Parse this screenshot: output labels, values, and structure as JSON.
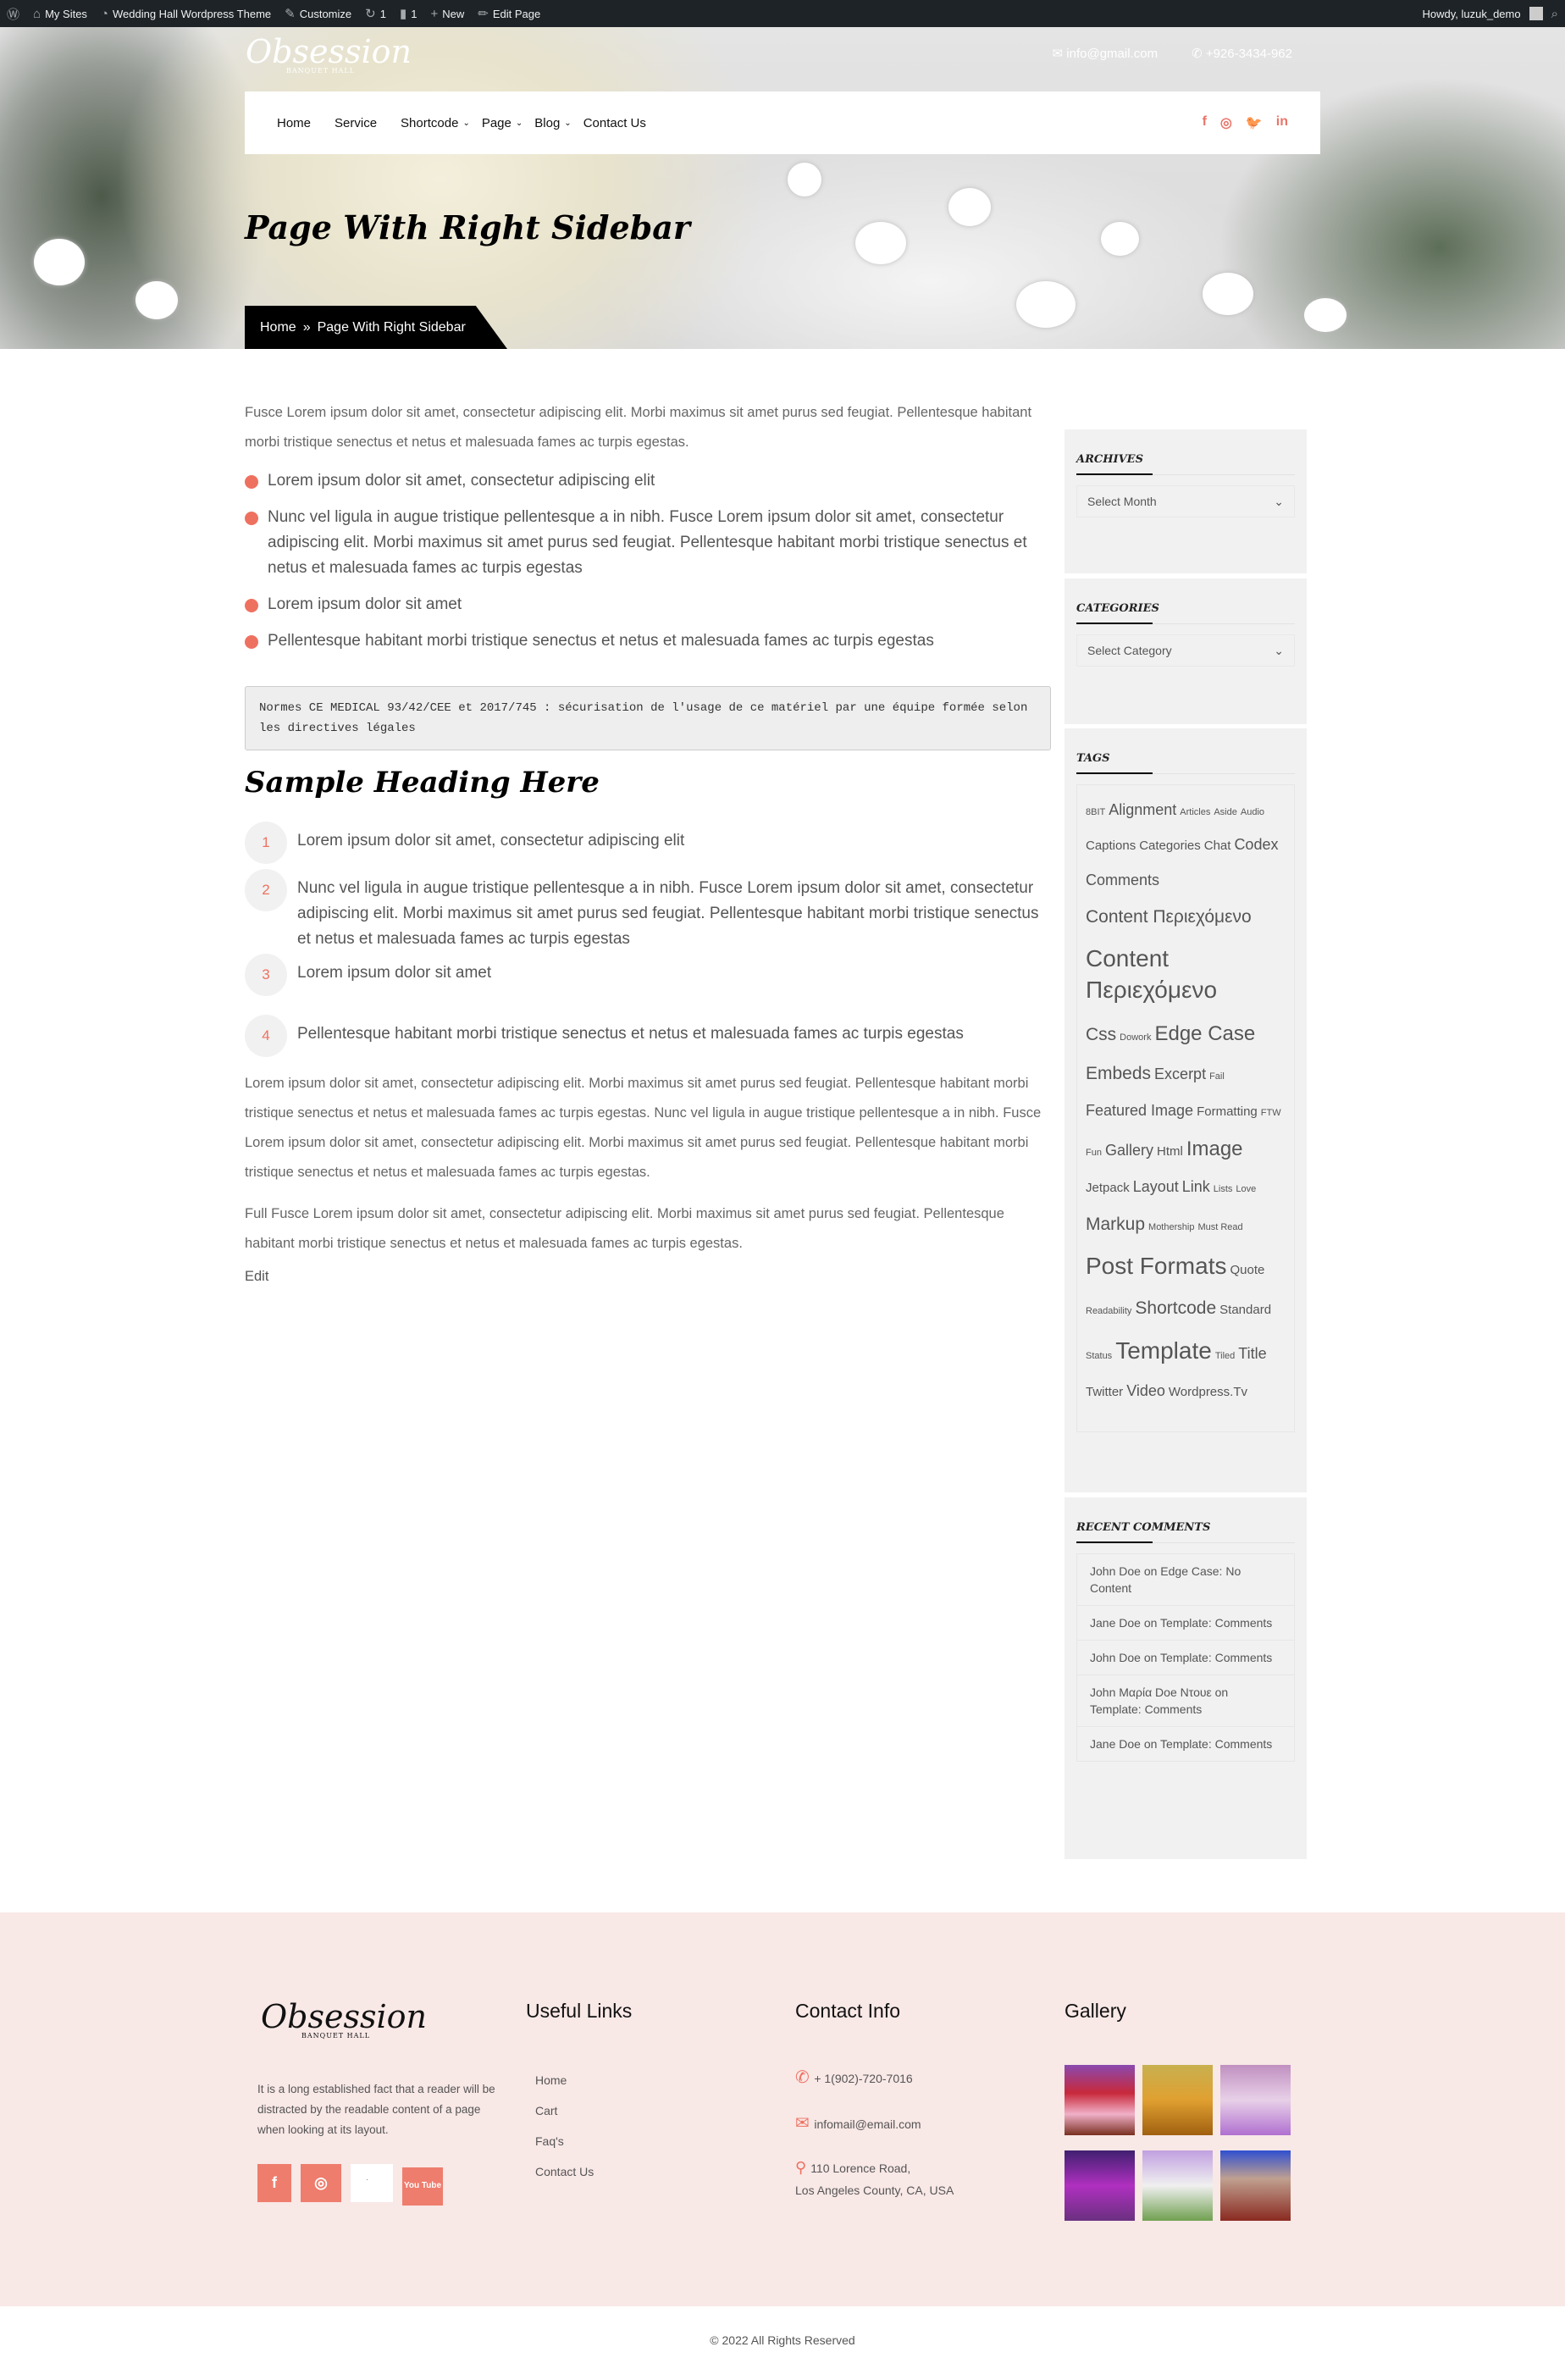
{
  "adminbar": {
    "items": [
      {
        "icon": "wordpress-icon",
        "label": ""
      },
      {
        "icon": "my-sites-icon",
        "label": "My Sites"
      },
      {
        "icon": "dashboard-icon",
        "label": "Wedding Hall Wordpress Theme"
      },
      {
        "icon": "brush-icon",
        "label": "Customize"
      },
      {
        "icon": "updates-icon",
        "label": "1"
      },
      {
        "icon": "comment-icon",
        "label": "1"
      },
      {
        "icon": "plus-icon",
        "label": "New"
      },
      {
        "icon": "pencil-icon",
        "label": "Edit Page"
      }
    ],
    "howdy": "Howdy, luzuk_demo"
  },
  "header": {
    "logo": "Obsession",
    "logo_sub": "BANQUET HALL",
    "email": "info@gmail.com",
    "phone": "+926-3434-962",
    "nav": [
      {
        "label": "Home",
        "dropdown": false
      },
      {
        "label": "Service",
        "dropdown": false
      },
      {
        "label": "Shortcode",
        "dropdown": true
      },
      {
        "label": "Page",
        "dropdown": true
      },
      {
        "label": "Blog",
        "dropdown": true
      },
      {
        "label": "Contact Us",
        "dropdown": false
      }
    ],
    "social": [
      "f",
      "◎",
      "🐦",
      "in"
    ]
  },
  "hero": {
    "title": "Page With Right Sidebar",
    "breadcrumb": [
      "Home",
      "Page With Right Sidebar"
    ]
  },
  "main": {
    "intro": "Fusce Lorem ipsum dolor sit amet, consectetur adipiscing elit. Morbi maximus sit amet purus sed feugiat. Pellentesque habitant morbi tristique senectus et netus et malesuada fames ac turpis egestas.",
    "bullets": [
      "Lorem ipsum dolor sit amet, consectetur adipiscing elit",
      "Nunc vel ligula in augue tristique pellentesque a in nibh. Fusce Lorem ipsum dolor sit amet, consectetur adipiscing elit. Morbi maximus sit amet purus sed feugiat. Pellentesque habitant morbi tristique senectus et netus et malesuada fames ac turpis egestas",
      "Lorem ipsum dolor sit amet",
      "Pellentesque habitant morbi tristique senectus et netus et malesuada fames ac turpis egestas"
    ],
    "pre": "Normes CE MEDICAL 93/42/CEE et 2017/745 : sécurisation de l'usage de ce matériel par une équipe formée selon les directives légales",
    "heading": "Sample Heading Here",
    "numbered": [
      "Lorem ipsum dolor sit amet, consectetur adipiscing elit",
      "Nunc vel ligula in augue tristique pellentesque a in nibh. Fusce Lorem ipsum dolor sit amet, consectetur adipiscing elit. Morbi maximus sit amet purus sed feugiat. Pellentesque habitant morbi tristique senectus et netus et malesuada fames ac turpis egestas",
      "Lorem ipsum dolor sit amet",
      "Pellentesque habitant morbi tristique senectus et netus et malesuada fames ac turpis egestas"
    ],
    "para1": "Lorem ipsum dolor sit amet, consectetur adipiscing elit. Morbi maximus sit amet purus sed feugiat. Pellentesque habitant morbi tristique senectus et netus et malesuada fames ac turpis egestas. Nunc vel ligula in augue tristique pellentesque a in nibh. Fusce Lorem ipsum dolor sit amet, consectetur adipiscing elit. Morbi maximus sit amet purus sed feugiat. Pellentesque habitant morbi tristique senectus et netus et malesuada fames ac turpis egestas.",
    "para2": "Full Fusce Lorem ipsum dolor sit amet, consectetur adipiscing elit. Morbi maximus sit amet purus sed feugiat. Pellentesque habitant morbi tristique senectus et netus et malesuada fames ac turpis egestas.",
    "edit": "Edit"
  },
  "sidebar": {
    "archives": {
      "title": "ARCHIVES",
      "select": "Select Month"
    },
    "categories": {
      "title": "CATEGORIES",
      "select": "Select Category"
    },
    "tags": {
      "title": "TAGS",
      "items": [
        [
          "8BIT",
          1
        ],
        [
          "Alignment",
          3
        ],
        [
          "Articles",
          1
        ],
        [
          "Aside",
          1
        ],
        [
          "Audio",
          1
        ],
        [
          "Captions",
          2
        ],
        [
          "Categories",
          2
        ],
        [
          "Chat",
          2
        ],
        [
          "Codex",
          3
        ],
        [
          "Comments",
          3
        ],
        [
          "Content Περιεχόμενο",
          4
        ],
        [
          "Content Περιεχόμενο",
          6
        ],
        [
          "Css",
          4
        ],
        [
          "Dowork",
          1
        ],
        [
          "Edge Case",
          5
        ],
        [
          "Embeds",
          4
        ],
        [
          "Excerpt",
          3
        ],
        [
          "Fail",
          1
        ],
        [
          "Featured Image",
          3
        ],
        [
          "Formatting",
          2
        ],
        [
          "FTW",
          1
        ],
        [
          "Fun",
          1
        ],
        [
          "Gallery",
          3
        ],
        [
          "Html",
          2
        ],
        [
          "Image",
          5
        ],
        [
          "Jetpack",
          2
        ],
        [
          "Layout",
          3
        ],
        [
          "Link",
          3
        ],
        [
          "Lists",
          1
        ],
        [
          "Love",
          1
        ],
        [
          "Markup",
          4
        ],
        [
          "Mothership",
          1
        ],
        [
          "Must Read",
          1
        ],
        [
          "Post Formats",
          6
        ],
        [
          "Quote",
          2
        ],
        [
          "Readability",
          1
        ],
        [
          "Shortcode",
          4
        ],
        [
          "Standard",
          2
        ],
        [
          "Status",
          1
        ],
        [
          "Template",
          6
        ],
        [
          "Tiled",
          1
        ],
        [
          "Title",
          3
        ],
        [
          "Twitter",
          2
        ],
        [
          "Video",
          3
        ],
        [
          "Wordpress.Tv",
          2
        ]
      ]
    },
    "recent_comments": {
      "title": "RECENT COMMENTS",
      "items": [
        "John Doe on Edge Case: No Content",
        "Jane Doe on Template: Comments",
        "John Doe on Template: Comments",
        "John Μαρία Doe Ντουε on Template: Comments",
        "Jane Doe on Template: Comments"
      ]
    }
  },
  "footer": {
    "about": "It is a long established fact that a reader will be distracted by the readable content of a page when looking at its layout.",
    "social": [
      "f",
      "◎",
      "🐦",
      "You Tube"
    ],
    "useful_links": {
      "title": "Useful Links",
      "items": [
        "Home",
        "Cart",
        "Faq's",
        "Contact Us"
      ]
    },
    "contact": {
      "title": "Contact Info",
      "phone": "+ 1(902)-720-7016",
      "email": "infomail@email.com",
      "address1": "110 Lorence Road,",
      "address2": "Los Angeles County, CA, USA"
    },
    "gallery": {
      "title": "Gallery"
    },
    "copyright": "© 2022 All Rights Reserved"
  },
  "colors": {
    "accent": "#ee7160",
    "footer_bg": "#f8e8e6",
    "adminbar": "#1d2327"
  }
}
